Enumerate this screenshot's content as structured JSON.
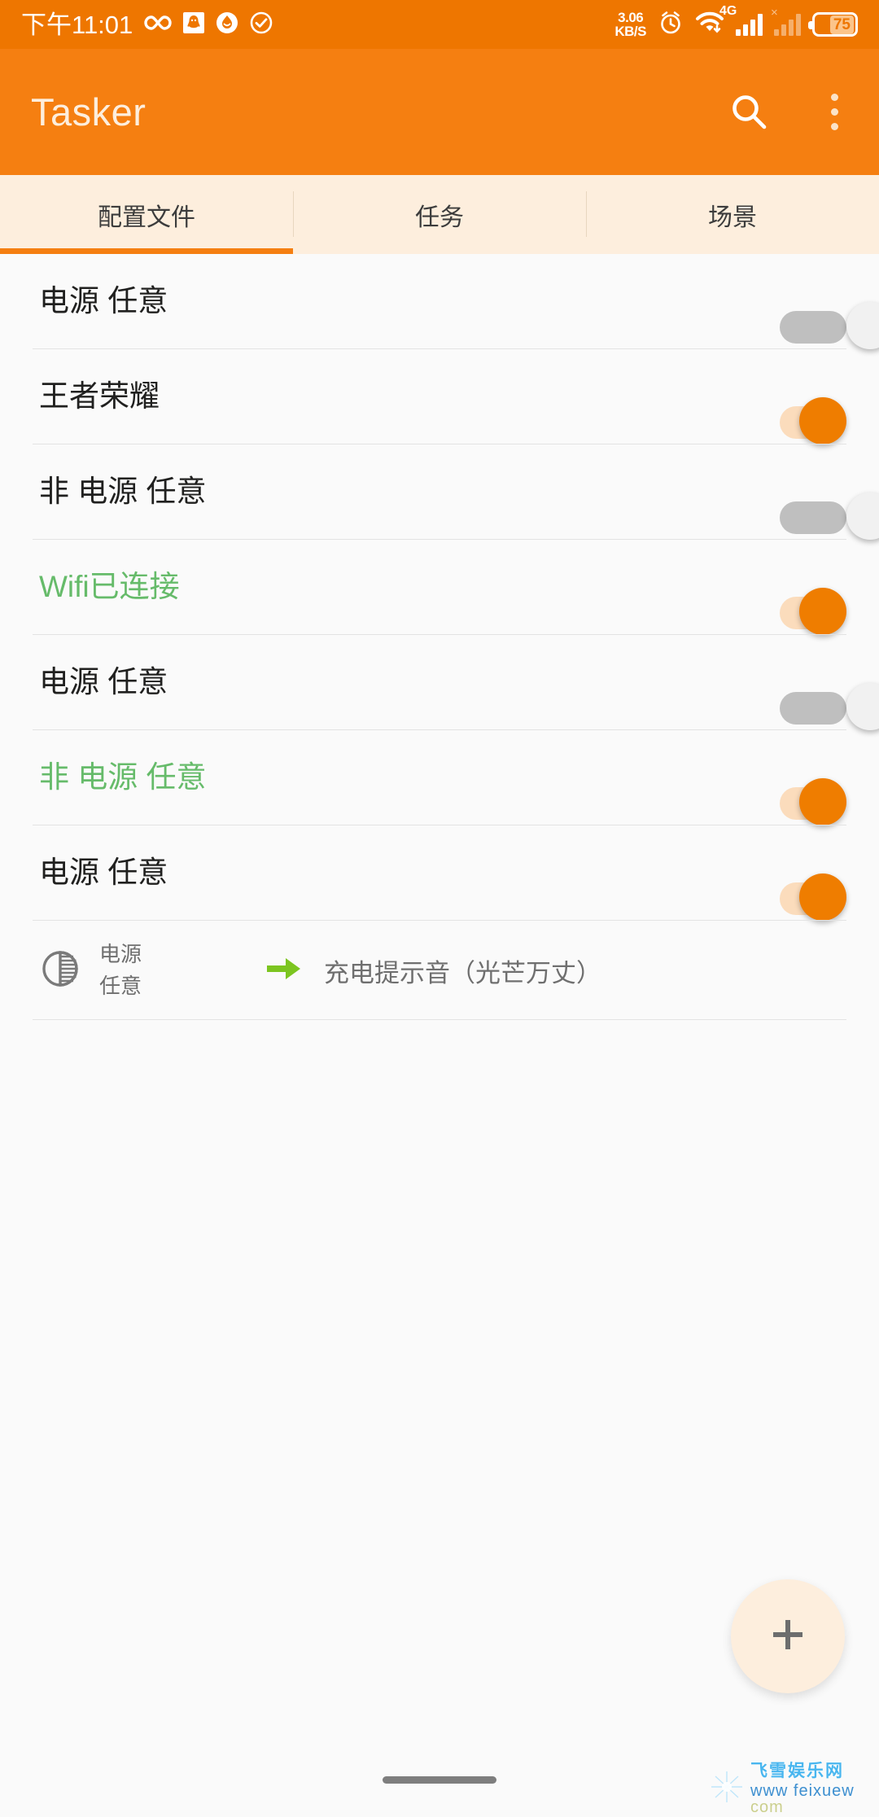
{
  "statusbar": {
    "time": "下午11:01",
    "left_icons": [
      "infinity-icon",
      "qq-icon",
      "droplet-face-icon",
      "check-circle-icon"
    ],
    "network_speed_value": "3.06",
    "network_speed_unit": "KB/S",
    "right_icons": [
      "alarm-clock-icon",
      "wifi-icon",
      "signal-4g-icon",
      "signal-inactive-icon"
    ],
    "mobile_network_label": "4G",
    "battery_level": "75",
    "background_color": "#ee7600"
  },
  "appbar": {
    "title": "Tasker",
    "search_icon": "search-icon",
    "overflow_icon": "kebab-menu-icon",
    "background_color": "#f57f11",
    "title_color": "#fdeedd"
  },
  "tabs": {
    "items": [
      {
        "label": "配置文件",
        "selected": true
      },
      {
        "label": "任务",
        "selected": false
      },
      {
        "label": "场景",
        "selected": false
      }
    ],
    "indicator_color": "#f57f11",
    "background_color": "#fdeedd"
  },
  "profiles": [
    {
      "name": "电源 任意",
      "enabled": false,
      "highlighted": false
    },
    {
      "name": "王者荣耀",
      "enabled": true,
      "highlighted": false
    },
    {
      "name": "非 电源 任意",
      "enabled": false,
      "highlighted": false
    },
    {
      "name": "Wifi已连接",
      "enabled": true,
      "highlighted": true
    },
    {
      "name": "电源 任意",
      "enabled": false,
      "highlighted": false
    },
    {
      "name": "非 电源 任意",
      "enabled": true,
      "highlighted": true
    },
    {
      "name": "电源 任意",
      "enabled": true,
      "highlighted": false
    }
  ],
  "expanded_detail": {
    "context_icon": "power-contrast-icon",
    "context_line1": "电源",
    "context_line2": "任意",
    "arrow_icon": "green-arrow-right-icon",
    "task_name": "充电提示音（光芒万丈）"
  },
  "fab": {
    "icon": "plus-icon",
    "label": "+",
    "background_color": "#fdeedd"
  },
  "navbar": {
    "home_pill": "home-gesture-pill"
  },
  "watermark": {
    "logo_icon": "snowflake-moon-logo",
    "site_name": "飞雪娱乐网",
    "url_www": "www",
    "url_domain": "feixuew",
    "url_tld": "com"
  },
  "colors": {
    "accent_orange": "#ef7d00",
    "highlight_green": "#66bb6a",
    "track_on": "#fbdcbc",
    "track_off": "#bfbfbf"
  }
}
